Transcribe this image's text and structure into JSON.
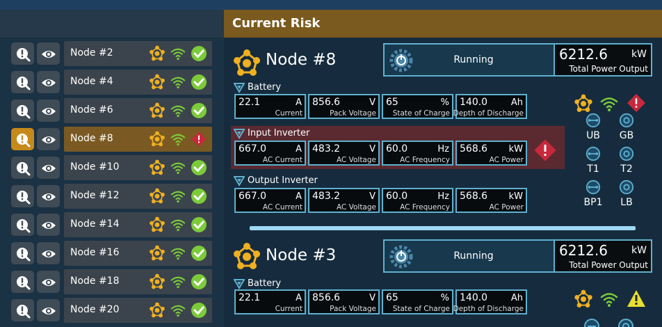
{
  "sidebar": {
    "items": [
      {
        "label": "Node #2",
        "status": "ok"
      },
      {
        "label": "Node #4",
        "status": "ok"
      },
      {
        "label": "Node #6",
        "status": "ok"
      },
      {
        "label": "Node #8",
        "status": "risk",
        "selected": true
      },
      {
        "label": "Node #10",
        "status": "ok"
      },
      {
        "label": "Node #12",
        "status": "ok"
      },
      {
        "label": "Node #14",
        "status": "ok"
      },
      {
        "label": "Node #16",
        "status": "ok"
      },
      {
        "label": "Node #18",
        "status": "ok"
      },
      {
        "label": "Node #20",
        "status": "ok"
      }
    ]
  },
  "main": {
    "title": "Current Risk",
    "cards": [
      {
        "name": "Node #8",
        "status": "Running",
        "power": {
          "value": "6212.6",
          "unit": "kW",
          "label": "Total Power Output"
        },
        "battery": {
          "title": "Battery",
          "metrics": [
            {
              "value": "22.1",
              "unit": "A",
              "label": "Current"
            },
            {
              "value": "856.6",
              "unit": "V",
              "label": "Pack Voltage"
            },
            {
              "value": "65",
              "unit": "%",
              "label": "State of Charge"
            },
            {
              "value": "140.0",
              "unit": "Ah",
              "label": "Depth of Discharge"
            }
          ]
        },
        "input_inverter": {
          "title": "Input Inverter",
          "metrics": [
            {
              "value": "667.0",
              "unit": "A",
              "label": "AC Current"
            },
            {
              "value": "483.2",
              "unit": "V",
              "label": "AC Voltage"
            },
            {
              "value": "60.0",
              "unit": "Hz",
              "label": "AC Frequency"
            },
            {
              "value": "568.6",
              "unit": "kW",
              "label": "AC Power"
            }
          ]
        },
        "output_inverter": {
          "title": "Output Inverter",
          "metrics": [
            {
              "value": "667.0",
              "unit": "A",
              "label": "AC Current"
            },
            {
              "value": "483.2",
              "unit": "V",
              "label": "AC Voltage"
            },
            {
              "value": "60.0",
              "unit": "Hz",
              "label": "AC Frequency"
            },
            {
              "value": "568.6",
              "unit": "kW",
              "label": "AC Power"
            }
          ]
        },
        "connectors": [
          "UB",
          "GB",
          "T1",
          "T2",
          "BP1",
          "LB"
        ]
      },
      {
        "name": "Node #3",
        "status": "Running",
        "power": {
          "value": "6212.6",
          "unit": "kW",
          "label": "Total Power Output"
        },
        "battery": {
          "title": "Battery",
          "metrics": [
            {
              "value": "22.1",
              "unit": "A",
              "label": "Current"
            },
            {
              "value": "856.6",
              "unit": "V",
              "label": "Pack Voltage"
            },
            {
              "value": "65",
              "unit": "%",
              "label": "State of Charge"
            },
            {
              "value": "140.0",
              "unit": "Ah",
              "label": "Depth of Discharge"
            }
          ]
        }
      }
    ]
  },
  "colors": {
    "accent": "#f0b020",
    "ok": "#7ccb3a",
    "risk": "#c8283c",
    "warning": "#e8e030",
    "border": "#5fb1cf"
  },
  "icons": [
    "search-alert-icon",
    "eye-icon",
    "node-network-icon",
    "wifi-icon",
    "check-circle-icon",
    "alert-diamond-icon",
    "gear-power-icon",
    "warning-triangle-icon",
    "connector-icon"
  ]
}
